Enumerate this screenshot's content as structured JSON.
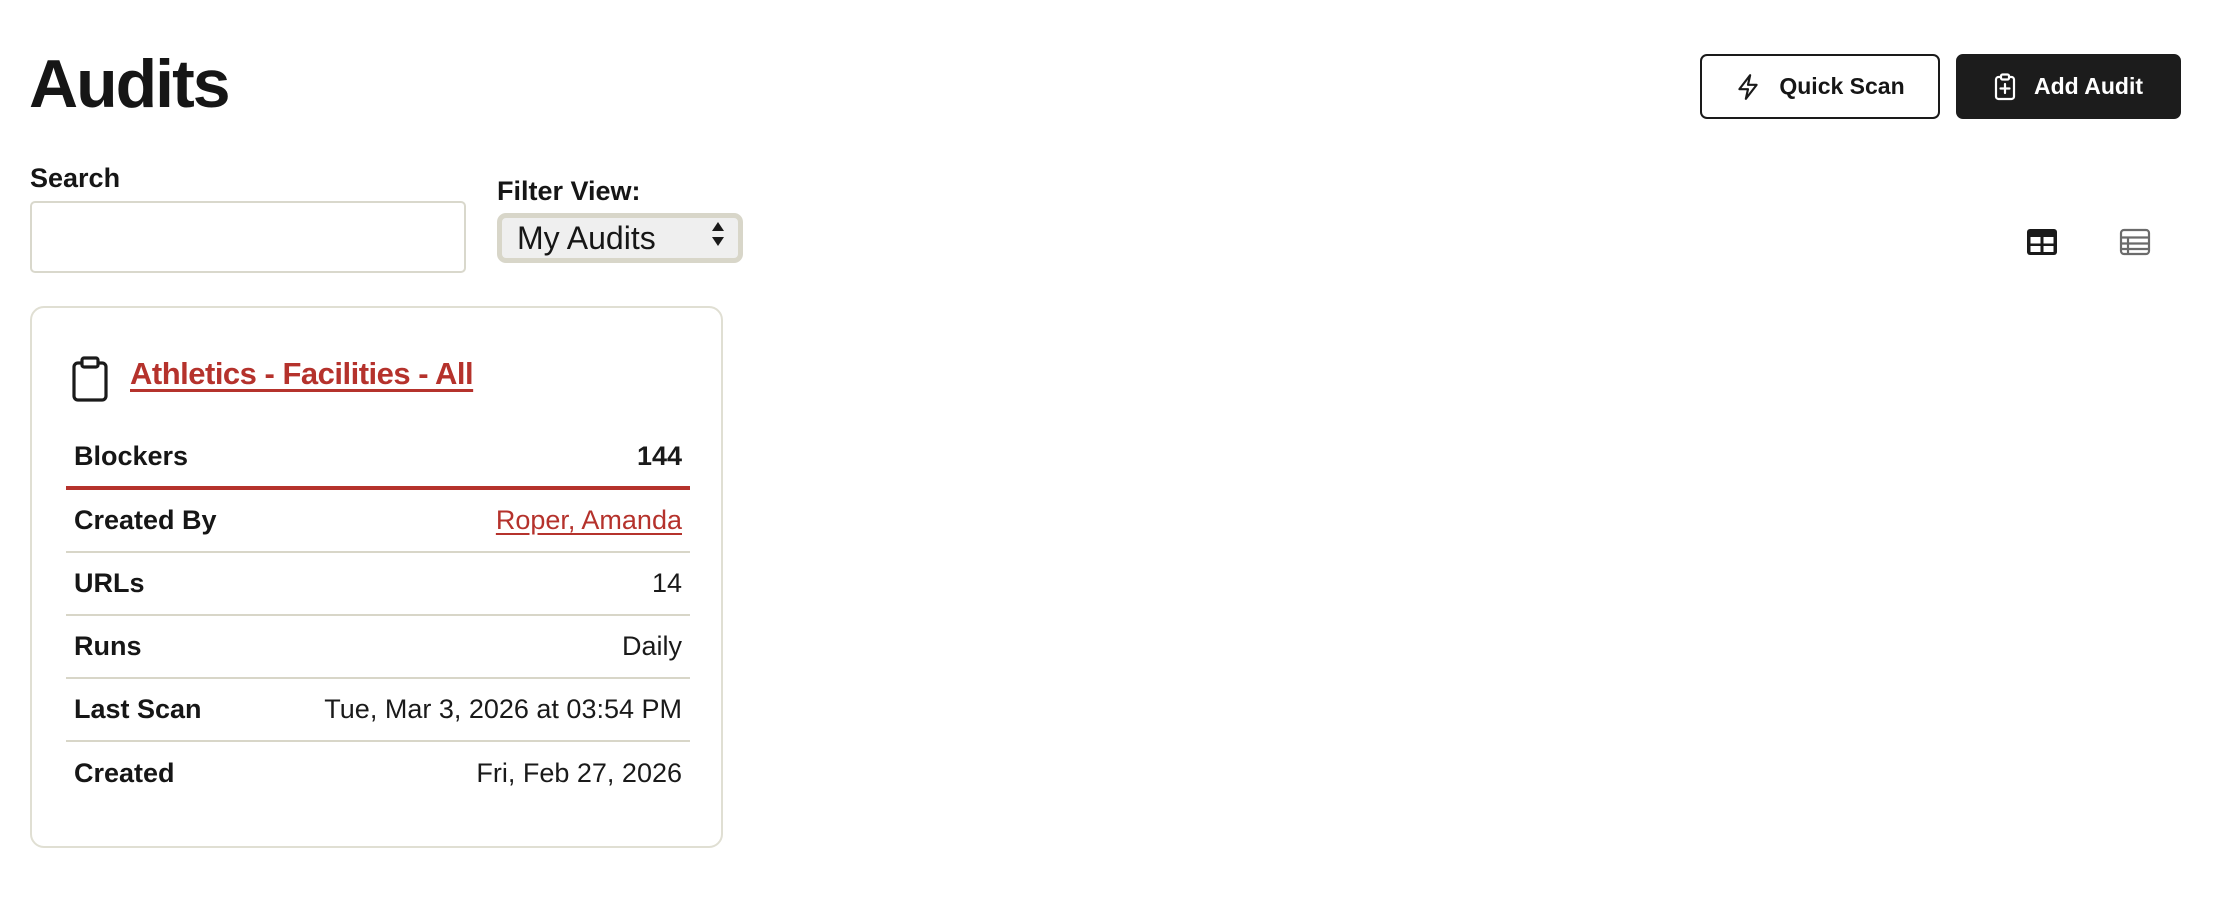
{
  "header": {
    "title": "Audits",
    "quick_scan_label": "Quick Scan",
    "add_audit_label": "Add Audit"
  },
  "search": {
    "label": "Search",
    "value": "",
    "placeholder": ""
  },
  "filter": {
    "label": "Filter View:",
    "selected": "My Audits"
  },
  "view_toggle": {
    "grid_icon": "grid-view-icon",
    "list_icon": "list-view-icon",
    "active": "grid"
  },
  "audit_card": {
    "title": "Athletics - Facilities - All",
    "icon": "clipboard-icon",
    "rows": [
      {
        "label": "Blockers",
        "value": "144"
      },
      {
        "label": "Created By",
        "value": "Roper, Amanda"
      },
      {
        "label": "URLs",
        "value": "14"
      },
      {
        "label": "Runs",
        "value": "Daily"
      },
      {
        "label": "Last Scan",
        "value": "Tue, Mar 3, 2026 at 03:54 PM"
      },
      {
        "label": "Created",
        "value": "Fri, Feb 27, 2026"
      }
    ]
  },
  "colors": {
    "accent": "#b5322c",
    "primary_button": "#1c1c1c",
    "border": "#d8d6c8"
  }
}
